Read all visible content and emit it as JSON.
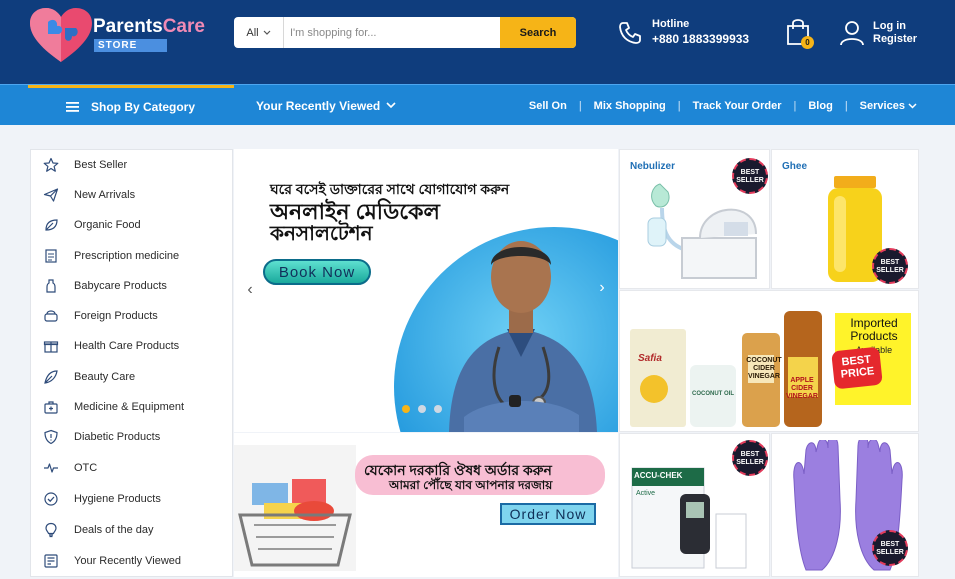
{
  "header": {
    "logo_name_part1": "Parents",
    "logo_name_part2": "Care",
    "logo_store": "STORE",
    "search": {
      "category": "All",
      "placeholder": "I'm shopping for...",
      "button": "Search"
    },
    "hotline_label": "Hotline",
    "hotline_number": "+880 1883399933",
    "cart_count": "0",
    "login": "Log in",
    "register": "Register"
  },
  "nav": {
    "category_button": "Shop By Category",
    "recently_viewed": "Your Recently Viewed",
    "links": [
      "Sell On",
      "Mix Shopping",
      "Track Your Order",
      "Blog",
      "Services"
    ]
  },
  "sidebar": {
    "items": [
      {
        "label": "Best Seller",
        "icon": "star-icon"
      },
      {
        "label": "New Arrivals",
        "icon": "paper-plane-icon"
      },
      {
        "label": "Organic Food",
        "icon": "leaf-icon"
      },
      {
        "label": "Prescription medicine",
        "icon": "prescription-icon"
      },
      {
        "label": "Babycare Products",
        "icon": "baby-bottle-icon"
      },
      {
        "label": "Foreign Products",
        "icon": "globe-box-icon"
      },
      {
        "label": "Health Care Products",
        "icon": "gift-box-icon"
      },
      {
        "label": "Beauty Care",
        "icon": "beauty-leaf-icon"
      },
      {
        "label": "Medicine & Equipment",
        "icon": "medical-kit-icon"
      },
      {
        "label": "Diabetic Products",
        "icon": "shield-icon"
      },
      {
        "label": "OTC",
        "icon": "heartbeat-icon"
      },
      {
        "label": "Hygiene Products",
        "icon": "check-circle-icon"
      },
      {
        "label": "Deals of the day",
        "icon": "lightbulb-icon"
      },
      {
        "label": "Your Recently Viewed",
        "icon": "history-icon"
      }
    ]
  },
  "hero": {
    "line1": "ঘরে বসেই ডাক্তারের সাথে যোগাযোগ করুন",
    "line2": "অনলাইন মেডিকেল",
    "line3": "কনসালটেশন",
    "button": "Book Now"
  },
  "promo": {
    "line1": "যেকোন দরকারি ঔষধ অর্ডার করুন",
    "line2": "আমরা পৌঁছে যাব আপনার দরজায়",
    "button": "Order Now"
  },
  "tiles": {
    "nebulizer_title": "Nebulizer",
    "ghee_title": "Ghee",
    "badge_line1": "BEST",
    "badge_line2": "SELLER",
    "imported_title": "Imported Products",
    "imported_sub": "Available",
    "best_price_line1": "BEST",
    "best_price_line2": "PRICE",
    "oil_label": "Safia",
    "coconut_oil_label": "COCONUT OIL",
    "coconut_vinegar_label": "COCONUT CIDER VINEGAR",
    "apple_vinegar_label": "APPLE CIDER VINEGAR",
    "accu_chek_label": "ACCU-CHEK",
    "accu_chek_sub": "Active"
  },
  "colors": {
    "header_bg": "#0f3d7d",
    "nav_bg": "#1e86d6",
    "accent_yellow": "#f6b417",
    "link_blue": "#1f6fb5"
  }
}
